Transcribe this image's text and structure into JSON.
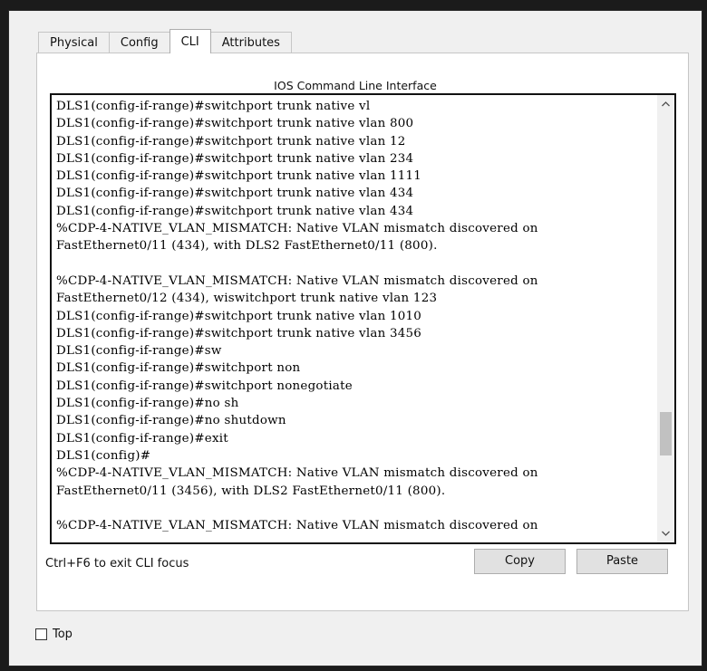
{
  "tabs": [
    {
      "label": "Physical"
    },
    {
      "label": "Config"
    },
    {
      "label": "CLI"
    },
    {
      "label": "Attributes"
    }
  ],
  "active_tab": "CLI",
  "cli": {
    "title": "IOS Command Line Interface",
    "lines": [
      "DLS1(config-if-range)#switchport trunk native vl",
      "DLS1(config-if-range)#switchport trunk native vlan 800",
      "DLS1(config-if-range)#switchport trunk native vlan 12",
      "DLS1(config-if-range)#switchport trunk native vlan 234",
      "DLS1(config-if-range)#switchport trunk native vlan 1111",
      "DLS1(config-if-range)#switchport trunk native vlan 434",
      "DLS1(config-if-range)#switchport trunk native vlan 434",
      "%CDP-4-NATIVE_VLAN_MISMATCH: Native VLAN mismatch discovered on",
      "FastEthernet0/11 (434), with DLS2 FastEthernet0/11 (800).",
      "",
      "%CDP-4-NATIVE_VLAN_MISMATCH: Native VLAN mismatch discovered on",
      "FastEthernet0/12 (434), wiswitchport trunk native vlan 123",
      "DLS1(config-if-range)#switchport trunk native vlan 1010",
      "DLS1(config-if-range)#switchport trunk native vlan 3456",
      "DLS1(config-if-range)#sw",
      "DLS1(config-if-range)#switchport non",
      "DLS1(config-if-range)#switchport nonegotiate",
      "DLS1(config-if-range)#no sh",
      "DLS1(config-if-range)#no shutdown",
      "DLS1(config-if-range)#exit",
      "DLS1(config)#",
      "%CDP-4-NATIVE_VLAN_MISMATCH: Native VLAN mismatch discovered on",
      "FastEthernet0/11 (3456), with DLS2 FastEthernet0/11 (800).",
      "",
      "%CDP-4-NATIVE_VLAN_MISMATCH: Native VLAN mismatch discovered on"
    ],
    "hint": "Ctrl+F6 to exit CLI focus",
    "copy_label": "Copy",
    "paste_label": "Paste"
  },
  "top_checkbox": {
    "label": "Top",
    "checked": false
  },
  "icons": {
    "scroll_up": "chevron-up-icon",
    "scroll_down": "chevron-down-icon"
  },
  "colors": {
    "window_bg": "#f0f0f0",
    "panel_bg": "#ffffff",
    "button_bg": "#e1e1e1",
    "terminal_border": "#111111"
  }
}
